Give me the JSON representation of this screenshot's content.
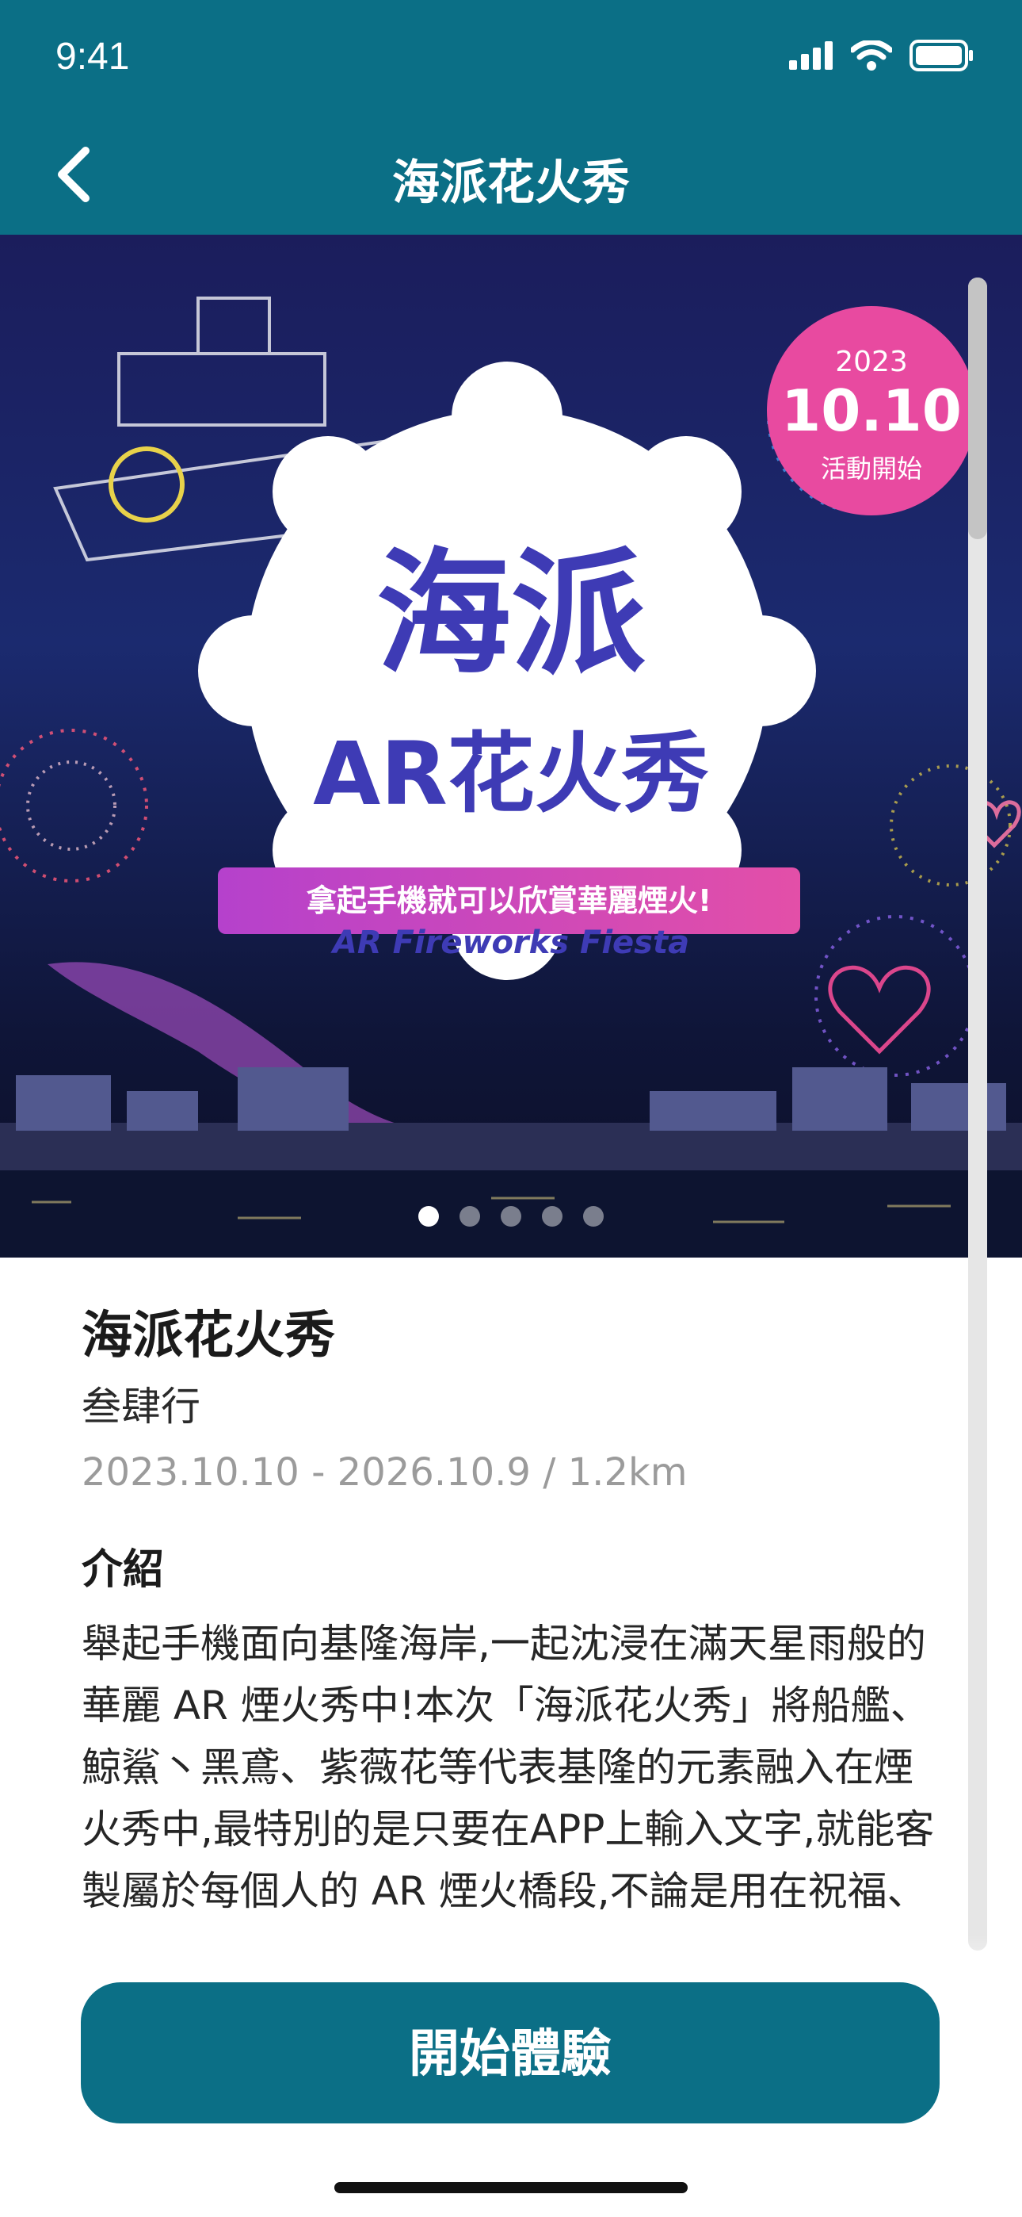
{
  "status_bar": {
    "time": "9:41"
  },
  "nav": {
    "title": "海派花火秀"
  },
  "hero": {
    "badge_year": "2023",
    "badge_date": "10.10",
    "badge_sub": "活動開始",
    "logo_line1": "海派",
    "logo_line2": "AR花火秀",
    "ribbon": "拿起手機就可以欣賞華麗煙火!",
    "logo_en": "AR Fireworks Fiesta",
    "pages_total": 5,
    "page_active": 1
  },
  "event": {
    "title": "海派花火秀",
    "organizer": "叁肆行",
    "meta": "2023.10.10 - 2026.10.9 / 1.2km",
    "intro_heading": "介紹",
    "intro_text": "舉起手機面向基隆海岸,一起沈浸在滿天星雨般的華麗 AR 煙火秀中!本次「海派花火秀」將船艦、鯨鯊丶黑鳶、紫薇花等代表基隆的元素融入在煙火秀中,最特別的是只要在APP上輸入文字,就能客製屬於每個人的 AR 煙火橋段,不論是用在祝福、告白、許願,讓人留下"
  },
  "cta": {
    "label": "開始體驗"
  },
  "colors": {
    "primary": "#0b6f86",
    "badge": "#e84aa0",
    "logo": "#3e3bb5"
  },
  "icons": [
    "chevron-left-icon",
    "signal-icon",
    "wifi-icon",
    "battery-icon"
  ]
}
